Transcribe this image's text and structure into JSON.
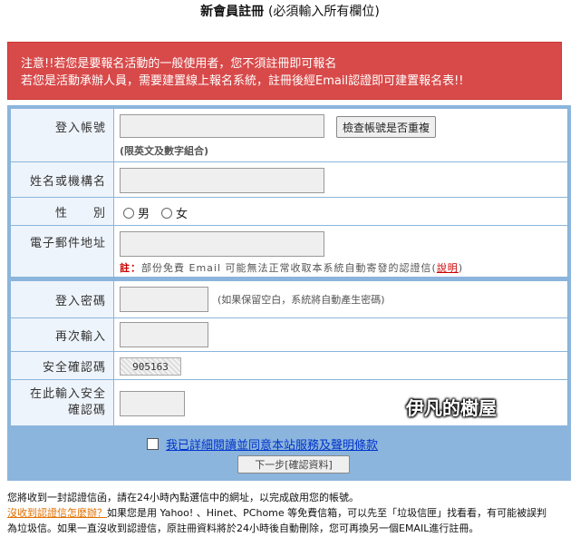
{
  "header": {
    "title": "新會員註冊",
    "subtitle": "(必須輸入所有欄位)"
  },
  "alert": {
    "line1": "注意!!若您是要報名活動的一般使用者，您不須註冊即可報名",
    "line2": "若您是活動承辦人員，需要建置線上報名系統，註冊後經Email認證即可建置報名表!!"
  },
  "form": {
    "account": {
      "label": "登入帳號",
      "value": "",
      "check_button": "檢查帳號是否重複",
      "hint": "(限英文及數字組合)"
    },
    "name": {
      "label": "姓名或機構名",
      "value": ""
    },
    "gender": {
      "label": "性　　別",
      "options": [
        "男",
        "女"
      ]
    },
    "email": {
      "label": "電子郵件地址",
      "value": "",
      "note_prefix": "註：",
      "note_text": "部份免費 Email 可能無法正常收取本系統自動寄發的認證信(",
      "note_link": "說明",
      "note_suffix": ")"
    },
    "password": {
      "label": "登入密碼",
      "value": "",
      "hint": "(如果保留空白，系統將自動產生密碼)"
    },
    "password_confirm": {
      "label": "再次輸入",
      "value": ""
    },
    "captcha": {
      "label": "安全確認碼",
      "code": "905163"
    },
    "captcha_input": {
      "label_line1": "在此輸入安全",
      "label_line2": "確認碼",
      "value": ""
    },
    "agree": {
      "text": "我已詳細閱讀並同意本站服務及聲明條款",
      "checked": false
    },
    "next_button": "下一步[確認資料]"
  },
  "watermark": "伊凡的樹屋",
  "footer": {
    "line1": "您將收到一封認證信函，請在24小時內點選信中的網址，以完成啟用您的帳號。",
    "link": "沒收到認證信怎麼辦？",
    "line2": "如果您是用 Yahoo! 、Hinet、PChome 等免費信箱，可以先至「垃圾信匣」找看看，有可能被誤判",
    "line3": "為垃圾信。如果一直沒收到認證信，原註冊資料將於24小時後自動刪除，您可再換另一個EMAIL進行註冊。"
  },
  "colors": {
    "alert_bg": "#d84a4a",
    "form_border": "#8bb5dc",
    "label_bg": "#eef4fb"
  }
}
